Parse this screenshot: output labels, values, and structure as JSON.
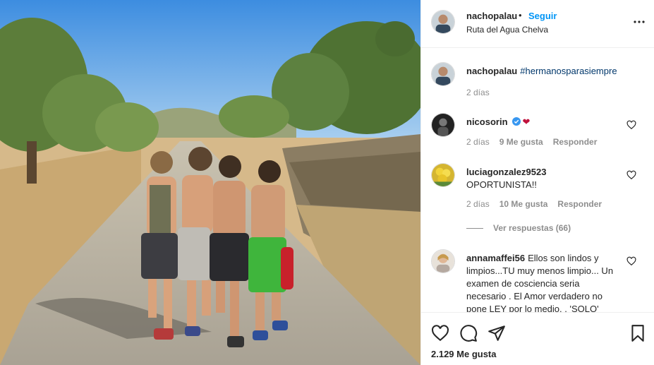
{
  "post": {
    "author": "nachopalau",
    "separator": "•",
    "follow_label": "Seguir",
    "location": "Ruta del Agua Chelva",
    "more_icon": "more-options-icon",
    "caption": {
      "username": "nachopalau",
      "hashtag": "#hermanosparasiempre",
      "time": "2 días"
    },
    "likes": "2.129 Me gusta"
  },
  "comments": [
    {
      "username": "nicosorin",
      "verified": true,
      "text": "",
      "emoji": "❤",
      "time": "2 días",
      "likes": "9 Me gusta",
      "reply": "Responder"
    },
    {
      "username": "luciagonzalez9523",
      "text": "OPORTUNISTA!!",
      "time": "2 días",
      "likes": "10 Me gusta",
      "reply": "Responder",
      "view_replies": "Ver respuestas (66)"
    },
    {
      "username": "annamaffei56",
      "text": "Ellos son lindos y limpios...TU muy menos limpio... Un examen de cosciencia seria necesario . El Amor verdadero no pone LEY por lo medio. . 'SOLO'"
    }
  ],
  "icons": {
    "like": "heart-icon",
    "comment": "comment-icon",
    "share": "share-icon",
    "save": "bookmark-icon"
  },
  "colors": {
    "link_blue": "#0095f6",
    "hashtag": "#00376b",
    "muted": "#8e8e8e",
    "border": "#efefef"
  }
}
